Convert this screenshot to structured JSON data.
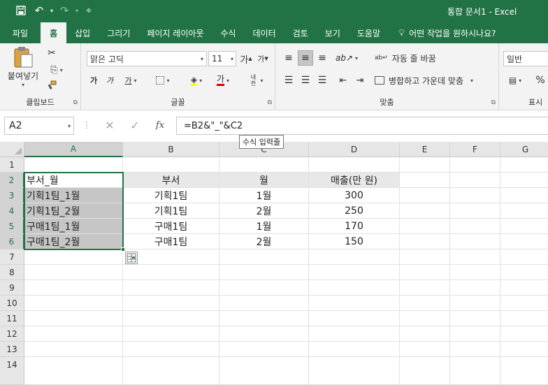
{
  "window": {
    "title": "통합 문서1  -  Excel"
  },
  "qat": {
    "save_icon": "save-icon",
    "undo_icon": "undo-icon",
    "redo_icon": "redo-icon",
    "customize_icon": "customize-qat-icon"
  },
  "tabs": [
    {
      "label": "파일"
    },
    {
      "label": "홈"
    },
    {
      "label": "삽입"
    },
    {
      "label": "그리기"
    },
    {
      "label": "페이지 레이아웃"
    },
    {
      "label": "수식"
    },
    {
      "label": "데이터"
    },
    {
      "label": "검토"
    },
    {
      "label": "보기"
    },
    {
      "label": "도움말"
    }
  ],
  "tellme": {
    "label": "어떤 작업을 원하시나요?"
  },
  "ribbon": {
    "clipboard": {
      "paste_label": "붙여넣기",
      "group_label": "클립보드"
    },
    "font": {
      "font_name": "맑은 고딕",
      "font_size": "11",
      "group_label": "글꼴",
      "bold": "가",
      "italic": "가",
      "underline": "가",
      "font_color_letter": "가",
      "phonetic": "내천"
    },
    "alignment": {
      "wrap_label": "자동 줄 바꿈",
      "merge_label": "병합하고 가운데 맞춤",
      "group_label": "맞춤"
    },
    "number": {
      "format": "일반",
      "group_label": "표시"
    }
  },
  "formula_bar": {
    "name_box": "A2",
    "formula": "=B2&\"_\"&C2",
    "tooltip": "수식 입력줄"
  },
  "columns": [
    "A",
    "B",
    "C",
    "D",
    "E",
    "F",
    "G"
  ],
  "rows": [
    "1",
    "2",
    "3",
    "4",
    "5",
    "6",
    "7",
    "8",
    "9",
    "10",
    "11",
    "12",
    "13",
    "14"
  ],
  "sheet": {
    "header": {
      "a": "부서_월",
      "b": "부서",
      "c": "월",
      "d": "매출(만 원)"
    },
    "data": [
      {
        "a": "기획1팀_1월",
        "b": "기획1팀",
        "c": "1월",
        "d": "300"
      },
      {
        "a": "기획1팀_2월",
        "b": "기획1팀",
        "c": "2월",
        "d": "250"
      },
      {
        "a": "구매1팀_1월",
        "b": "구매1팀",
        "c": "1월",
        "d": "170"
      },
      {
        "a": "구매1팀_2월",
        "b": "구매1팀",
        "c": "2월",
        "d": "150"
      }
    ]
  },
  "colors": {
    "accent": "#217346",
    "selection_fill": "#c6c6c6",
    "header_fill": "#e8e8e8"
  }
}
